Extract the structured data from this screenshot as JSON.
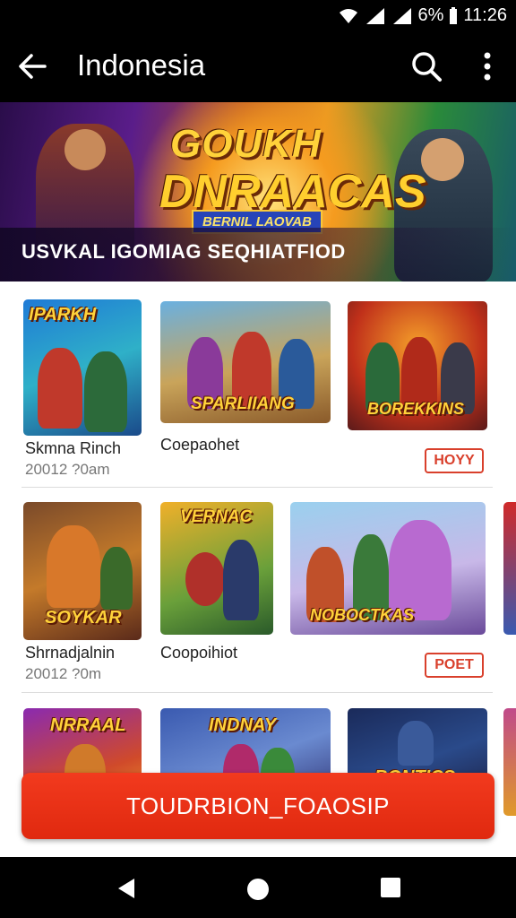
{
  "status_bar": {
    "battery": "6%",
    "time": "11:26"
  },
  "app_bar": {
    "title": "Indonesia"
  },
  "banner": {
    "title_line1": "GOUKH",
    "title_line2": "DNRAACAS",
    "ribbon": "BERNIL LAOVAB",
    "subtitle": "USVKAL IGOMIAG SEQHIATFIOD"
  },
  "rows": [
    {
      "items": [
        {
          "art_text": "IPARKH",
          "name": "Skmna Rinch",
          "meta": "20012 ?0am"
        },
        {
          "art_text": "SPARLIIANG",
          "name": "Coepaohet",
          "meta": ""
        },
        {
          "art_text": "BOREKKINS",
          "name": "",
          "meta": "",
          "button": "HOYY"
        }
      ]
    },
    {
      "items": [
        {
          "art_text": "SOYKAR",
          "name": "Shrnadjalnin",
          "meta": "20012 ?0m"
        },
        {
          "art_text": "VERNAC",
          "name": "Coopoihiot",
          "meta": ""
        },
        {
          "art_text": "NOBOCTKAS",
          "name": "",
          "meta": "",
          "button": "POET"
        }
      ]
    },
    {
      "items": [
        {
          "art_text": "NRRAAL"
        },
        {
          "art_text": "INDNAY"
        },
        {
          "art_text": "BONTICS"
        }
      ]
    }
  ],
  "cta": {
    "label": "TOUDRBION_FOAOSIP"
  },
  "colors": {
    "accent": "#e0290f",
    "pill": "#d9402c",
    "title_gold": "#ffd23a"
  }
}
